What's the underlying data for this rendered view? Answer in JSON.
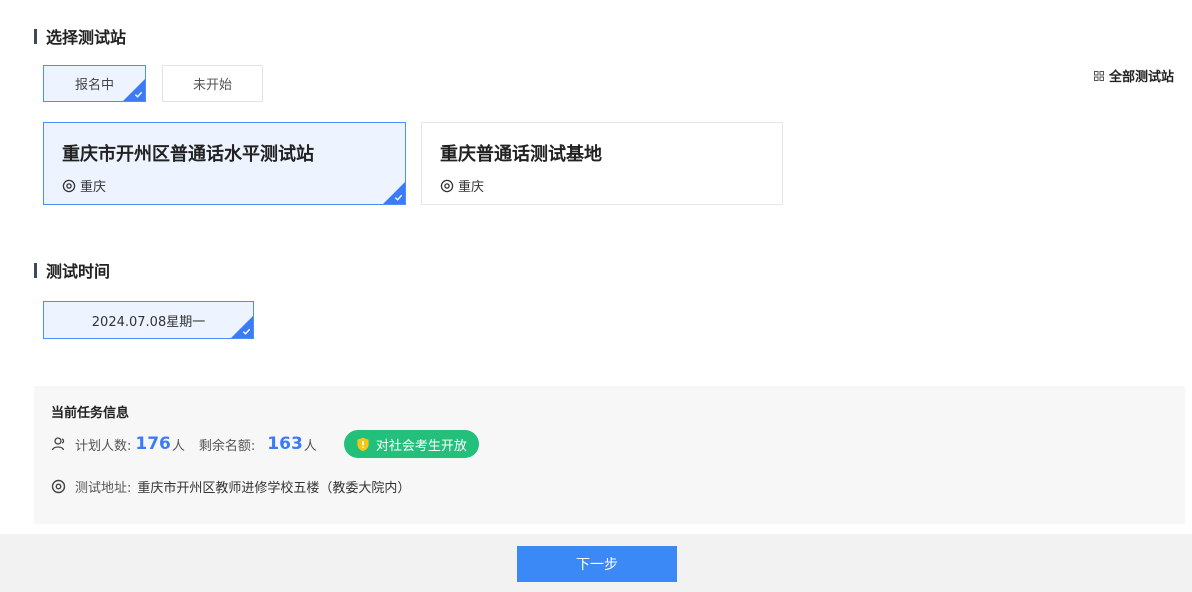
{
  "station_section": {
    "title": "选择测试站",
    "tabs": [
      {
        "label": "报名中",
        "active": true
      },
      {
        "label": "未开始",
        "active": false
      }
    ],
    "all_stations_label": "全部测试站",
    "cards": [
      {
        "name": "重庆市开州区普通话水平测试站",
        "location": "重庆",
        "selected": true
      },
      {
        "name": "重庆普通话测试基地",
        "location": "重庆",
        "selected": false
      }
    ]
  },
  "time_section": {
    "title": "测试时间",
    "selected_date": "2024.07.08星期一"
  },
  "task_info": {
    "title": "当前任务信息",
    "planned_label": "计划人数:",
    "planned_count": "176",
    "remaining_label": "剩余名额:",
    "remaining_count": "163",
    "unit": "人",
    "open_badge": "对社会考生开放",
    "address_label": "测试地址:",
    "address": "重庆市开州区教师进修学校五楼（教委大院内）"
  },
  "footer": {
    "next_label": "下一步"
  },
  "colors": {
    "accent": "#3b7cf6",
    "selected_bg": "#eef4ff",
    "badge_green": "#22c07a",
    "panel_bg": "#f7f7f7"
  },
  "icons": {
    "grid": "grid-icon",
    "location": "location-icon",
    "people": "people-icon",
    "shield": "shield-icon",
    "check": "check-icon"
  }
}
